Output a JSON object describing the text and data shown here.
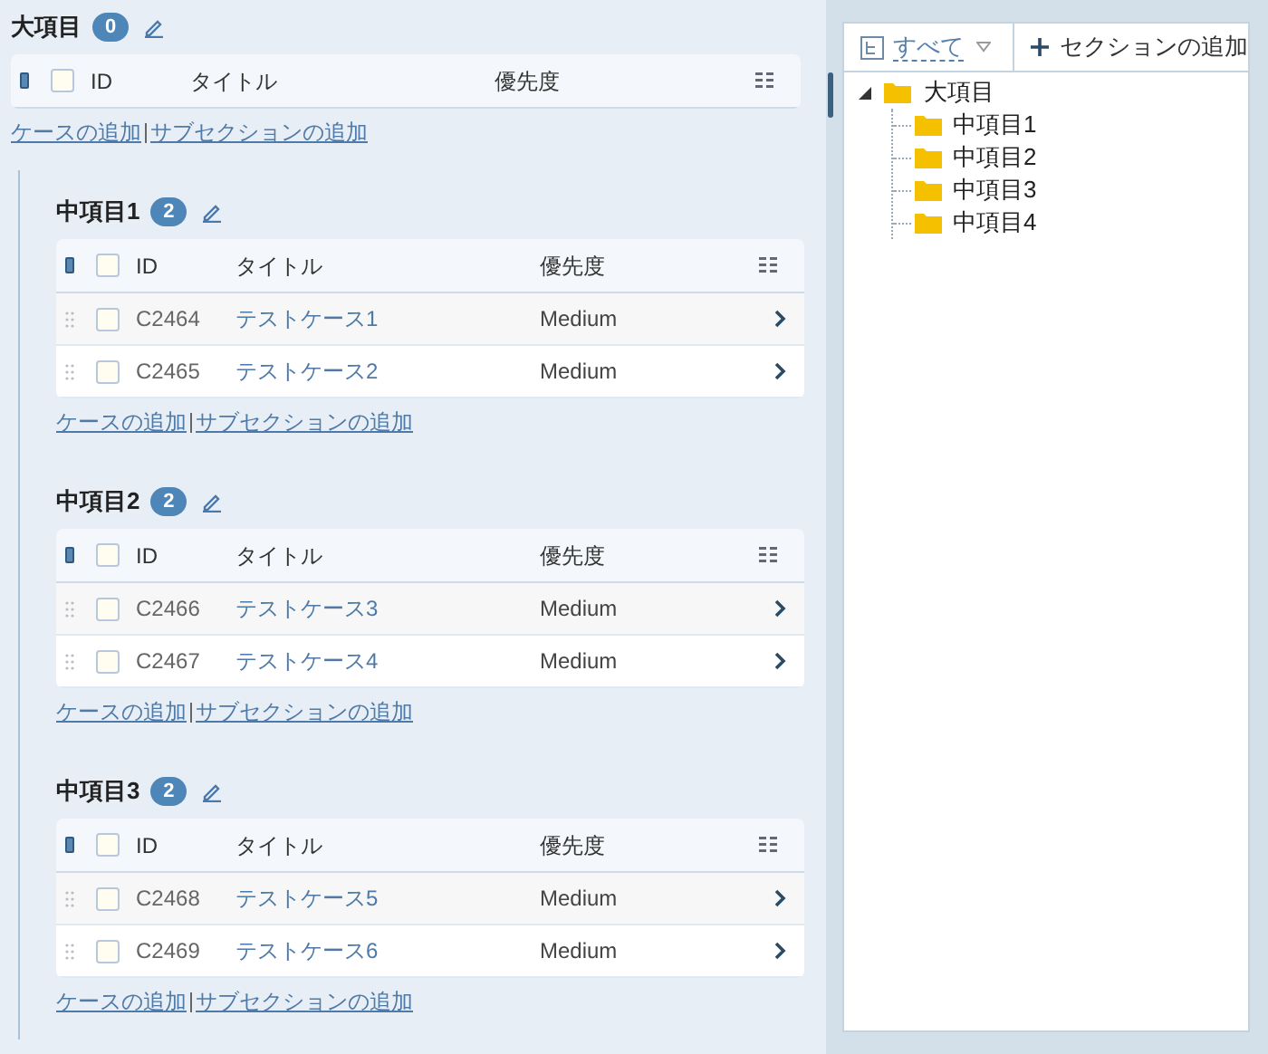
{
  "root_section": {
    "name": "大項目",
    "count": "0",
    "columns": [
      "ID",
      "タイトル",
      "優先度"
    ],
    "header_checked": false,
    "links": [
      "ケースの追加",
      "サブセクションの追加"
    ]
  },
  "subsections": [
    {
      "name": "中項目1",
      "count": "2",
      "columns": [
        "ID",
        "タイトル",
        "優先度"
      ],
      "header_checked": false,
      "rows": [
        {
          "id": "C2464",
          "title": "テストケース1",
          "priority": "Medium",
          "checked": false
        },
        {
          "id": "C2465",
          "title": "テストケース2",
          "priority": "Medium",
          "checked": false
        }
      ],
      "links": [
        "ケースの追加",
        "サブセクションの追加"
      ]
    },
    {
      "name": "中項目2",
      "count": "2",
      "columns": [
        "ID",
        "タイトル",
        "優先度"
      ],
      "header_checked": false,
      "rows": [
        {
          "id": "C2466",
          "title": "テストケース3",
          "priority": "Medium",
          "checked": false
        },
        {
          "id": "C2467",
          "title": "テストケース4",
          "priority": "Medium",
          "checked": false
        }
      ],
      "links": [
        "ケースの追加",
        "サブセクションの追加"
      ]
    },
    {
      "name": "中項目3",
      "count": "2",
      "columns": [
        "ID",
        "タイトル",
        "優先度"
      ],
      "header_checked": false,
      "rows": [
        {
          "id": "C2468",
          "title": "テストケース5",
          "priority": "Medium",
          "checked": false
        },
        {
          "id": "C2469",
          "title": "テストケース6",
          "priority": "Medium",
          "checked": false
        }
      ],
      "links": [
        "ケースの追加",
        "サブセクションの追加"
      ]
    }
  ],
  "tree_panel": {
    "filter": "すべて",
    "add_button": "セクションの追加",
    "root": {
      "label": "大項目",
      "expanded": true,
      "children": [
        {
          "label": "中項目1"
        },
        {
          "label": "中項目2"
        },
        {
          "label": "中項目3"
        },
        {
          "label": "中項目4"
        }
      ]
    }
  }
}
